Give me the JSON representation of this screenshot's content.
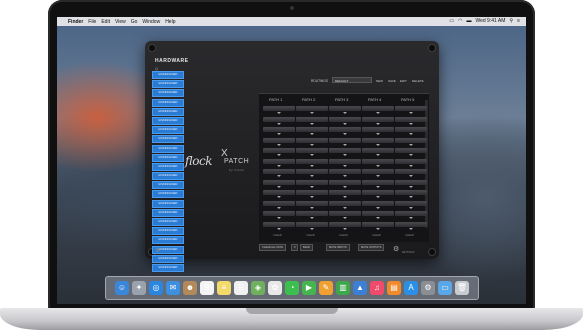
{
  "menubar": {
    "app_name": "Finder",
    "items": [
      "File",
      "Edit",
      "View",
      "Go",
      "Window",
      "Help"
    ],
    "clock": "Wed 9:41 AM",
    "icons": [
      "apple-icon",
      "airplay-icon",
      "wifi-icon",
      "battery-icon",
      "search-icon",
      "list-icon"
    ]
  },
  "app": {
    "hardware_title": "HARDWARE",
    "search_glyph": "Q",
    "hardware_items": [
      "UNASSIGNED",
      "UNASSIGNED",
      "UNASSIGNED",
      "UNASSIGNED",
      "UNASSIGNED",
      "UNASSIGNED",
      "UNASSIGNED",
      "UNASSIGNED",
      "UNASSIGNED",
      "UNASSIGNED",
      "UNASSIGNED",
      "UNASSIGNED",
      "UNASSIGNED",
      "UNASSIGNED",
      "UNASSIGNED",
      "UNASSIGNED",
      "UNASSIGNED",
      "UNASSIGNED",
      "UNASSIGNED",
      "UNASSIGNED",
      "UNASSIGNED",
      "UNASSIGNED"
    ],
    "logo_main": "flock",
    "logo_x": "X",
    "logo_patch": "PATCH",
    "logo_sub": "by Flock",
    "routings_label": "ROUTINGS",
    "routings_value": "DEFAULT",
    "buttons": {
      "new": "NEW",
      "save": "SAVE",
      "edit": "EDIT",
      "delete": "DELETE"
    },
    "columns": [
      {
        "label": "PATH",
        "num": "1"
      },
      {
        "label": "PATH",
        "num": "2"
      },
      {
        "label": "PATH",
        "num": "3"
      },
      {
        "label": "PATH",
        "num": "4"
      },
      {
        "label": "PATH",
        "num": "5"
      }
    ],
    "clear_label": "CLEAR",
    "bottom_buttons": [
      "CLEAR ALL PATH",
      "BANK",
      "MUTE INPUTS",
      "MUTE OUTPUTS"
    ],
    "bank_value": "0",
    "settings_label": "SETTINGS"
  },
  "dock": {
    "icons": [
      {
        "name": "finder-icon",
        "glyph": "☺",
        "color": "#3a86d8"
      },
      {
        "name": "launchpad-icon",
        "glyph": "✦",
        "color": "#9aa3ad"
      },
      {
        "name": "safari-icon",
        "glyph": "◎",
        "color": "#2a86e0"
      },
      {
        "name": "mail-icon",
        "glyph": "✉",
        "color": "#3d8fe0"
      },
      {
        "name": "contacts-icon",
        "glyph": "☻",
        "color": "#b28a5a"
      },
      {
        "name": "calendar-icon",
        "glyph": "9",
        "color": "#f4f4f4"
      },
      {
        "name": "notes-icon",
        "glyph": "≡",
        "color": "#f2d96a"
      },
      {
        "name": "reminders-icon",
        "glyph": "☰",
        "color": "#f0f0f0"
      },
      {
        "name": "maps-icon",
        "glyph": "◈",
        "color": "#6fb05e"
      },
      {
        "name": "photos-icon",
        "glyph": "✿",
        "color": "#e8e8e8"
      },
      {
        "name": "messages-icon",
        "glyph": "◔",
        "color": "#3cbf4f"
      },
      {
        "name": "facetime-icon",
        "glyph": "▶",
        "color": "#45b54f"
      },
      {
        "name": "pages-icon",
        "glyph": "✎",
        "color": "#f0a030"
      },
      {
        "name": "numbers-icon",
        "glyph": "▥",
        "color": "#3ea64b"
      },
      {
        "name": "keynote-icon",
        "glyph": "▲",
        "color": "#3b7fd6"
      },
      {
        "name": "music-icon",
        "glyph": "♫",
        "color": "#f04b6a"
      },
      {
        "name": "books-icon",
        "glyph": "▤",
        "color": "#f08a2a"
      },
      {
        "name": "appstore-icon",
        "glyph": "A",
        "color": "#2b8fe6"
      },
      {
        "name": "preferences-icon",
        "glyph": "⚙",
        "color": "#8a8f96"
      },
      {
        "name": "folder-icon",
        "glyph": "▭",
        "color": "#5aa7e8"
      },
      {
        "name": "trash-icon",
        "glyph": "🗑",
        "color": "#c8ccd2"
      }
    ]
  }
}
